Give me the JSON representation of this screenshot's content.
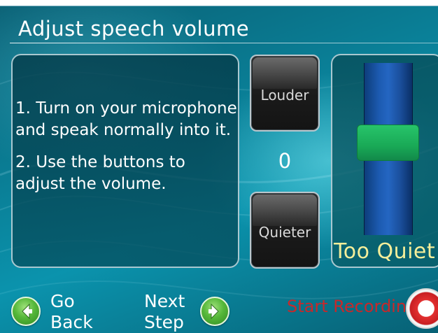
{
  "page": {
    "title": "Adjust speech volume"
  },
  "instructions": {
    "step1": "1. Turn on your microphone and speak normally into it.",
    "step2": "2. Use the buttons to adjust the volume."
  },
  "volume": {
    "louder_label": "Louder",
    "quieter_label": "Quieter",
    "value": "0"
  },
  "meter": {
    "level_fraction": 0.55,
    "status_label": "Too Quiet"
  },
  "nav": {
    "back_label": "Go Back",
    "next_label": "Next Step"
  },
  "record": {
    "label": "Start Recording"
  },
  "colors": {
    "meter_status": "#f4ee9a",
    "record_text": "#c8282a",
    "meter_thumb": "#1fb860",
    "nav_icon": "#56b83a"
  },
  "icons": {
    "back": "arrow-left-icon",
    "next": "arrow-right-icon",
    "record": "record-icon"
  }
}
